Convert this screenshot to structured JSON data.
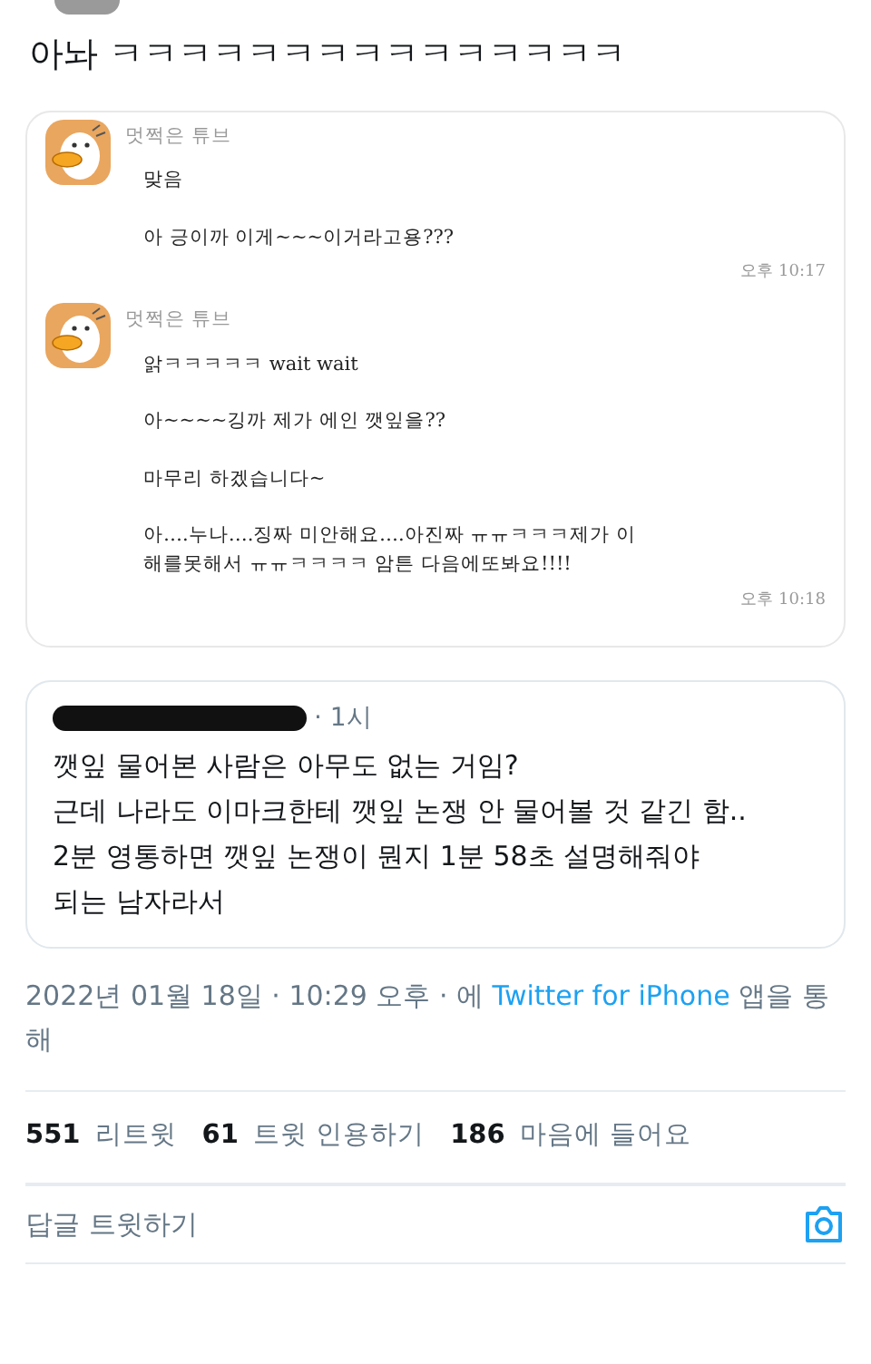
{
  "tweet": {
    "text": "아놔 ㅋㅋㅋㅋㅋㅋㅋㅋㅋㅋㅋㅋㅋㅋㅋ"
  },
  "chat_image": {
    "messages": [
      {
        "sender": "멋쩍은 튜브",
        "lines": [
          "맞음",
          "아 긍이까 이게~~~이거라고용???"
        ],
        "time": "오후 10:17"
      },
      {
        "sender": "멋쩍은 튜브",
        "lines": [
          "앍ㅋㅋㅋㅋㅋ wait wait",
          "아~~~~깅까 제가 에인 깻잎을??",
          "마무리 하겠습니다~",
          "아….누나….징짜 미안해요….아진짜 ㅠㅠㅋㅋㅋ제가 이\n해를못해서 ㅠㅠㅋㅋㅋㅋ 암튼 다음에또봐요!!!!"
        ],
        "time": "오후 10:18"
      }
    ]
  },
  "quoted_tweet": {
    "time": "· 1시",
    "lines": [
      "깻잎 물어본 사람은 아무도 없는 거임?",
      "근데 나라도 이마크한테 깻잎 논쟁 안 물어볼 것 같긴 함..",
      "2분 영통하면 깻잎 논쟁이 뭔지 1분 58초 설명해줘야",
      "되는 남자라서"
    ]
  },
  "meta": {
    "date": "2022년 01월 18일 · 10:29 오후 · 에",
    "source": "Twitter for iPhone",
    "suffix": "앱을 통해"
  },
  "stats": [
    {
      "count": "551",
      "label": "리트윗"
    },
    {
      "count": "61",
      "label": "트윗 인용하기"
    },
    {
      "count": "186",
      "label": "마음에 들어요"
    }
  ],
  "reply": {
    "placeholder": "답글 트윗하기"
  }
}
